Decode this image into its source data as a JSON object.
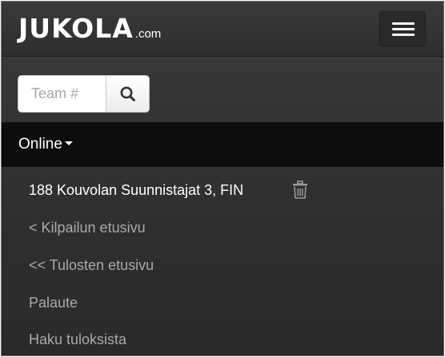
{
  "header": {
    "logo_main": "JUKOLA",
    "logo_suffix": ".com",
    "menu_icon": "hamburger-menu-icon"
  },
  "search": {
    "placeholder": "Team #",
    "value": "",
    "button_icon": "search-icon"
  },
  "online_menu": {
    "label": "Online",
    "caret_icon": "caret-down-icon"
  },
  "team": {
    "label": "188 Kouvolan Suunnistajat 3, FIN",
    "delete_icon": "trash-icon"
  },
  "links": [
    {
      "label": "< Kilpailun etusivu"
    },
    {
      "label": "<< Tulosten etusivu"
    },
    {
      "label": "Palaute"
    },
    {
      "label": "Haku tuloksista"
    }
  ],
  "colors": {
    "background": "#2f2f2f",
    "online_bar": "#0d0d0d",
    "link_text": "#a9a9a9",
    "active_text": "#ffffff"
  }
}
